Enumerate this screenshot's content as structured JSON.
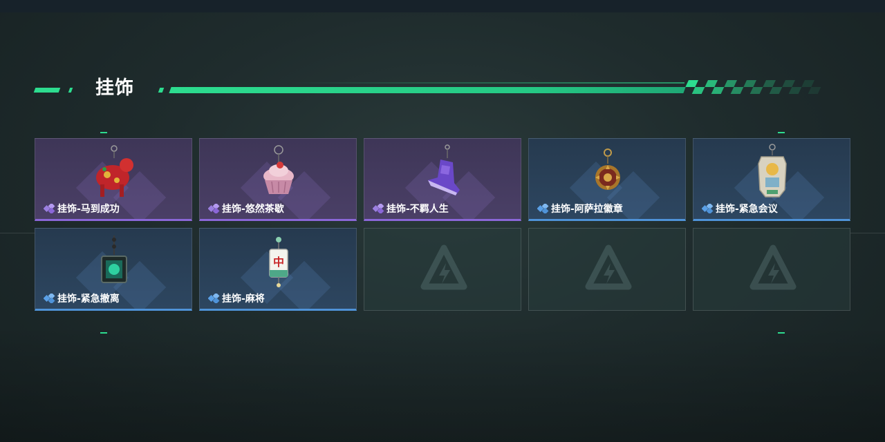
{
  "section": {
    "title": "挂饰"
  },
  "colors": {
    "accent": "#2ddc8f",
    "purple_rarity": "#8b67d8",
    "blue_rarity": "#4f93d8"
  },
  "items": [
    {
      "label": "挂饰-马到成功",
      "rarity": "purple",
      "icon": "red-horse-charm-icon"
    },
    {
      "label": "挂饰-悠然茶歇",
      "rarity": "purple",
      "icon": "cupcake-charm-icon"
    },
    {
      "label": "挂饰-不羁人生",
      "rarity": "purple",
      "icon": "purple-sneaker-charm-icon"
    },
    {
      "label": "挂饰-阿萨拉徽章",
      "rarity": "blue",
      "icon": "medallion-charm-icon"
    },
    {
      "label": "挂饰-紧急会议",
      "rarity": "blue",
      "icon": "plaque-charm-icon"
    },
    {
      "label": "挂饰-紧急撤离",
      "rarity": "blue",
      "icon": "green-cube-charm-icon"
    },
    {
      "label": "挂饰-麻将",
      "rarity": "blue",
      "icon": "mahjong-tile-charm-icon"
    }
  ],
  "empty_slots": 3,
  "empty_slot_icon": "delta-logo-icon"
}
